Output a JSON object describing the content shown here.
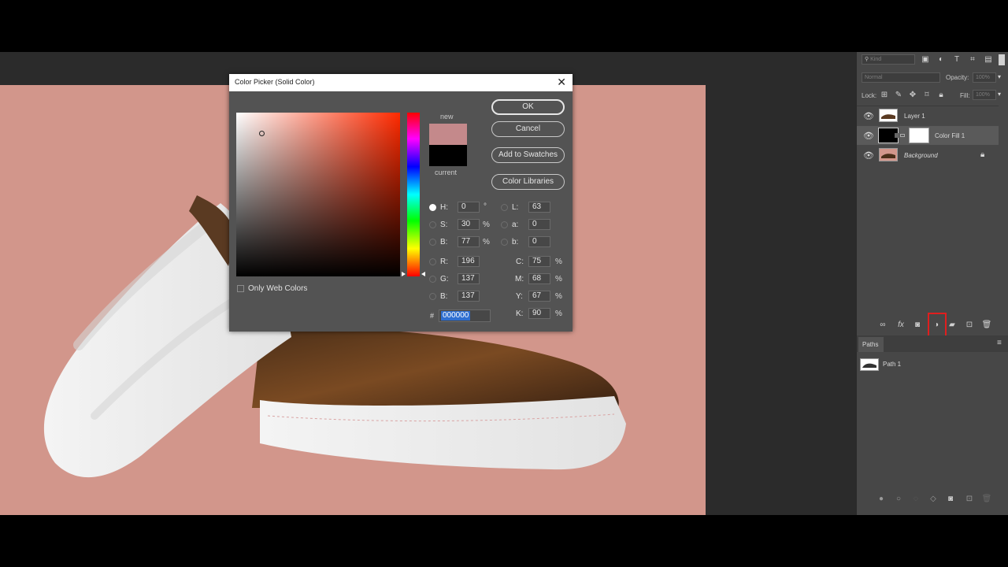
{
  "dialog": {
    "title": "Color Picker (Solid Color)",
    "buttons": {
      "ok": "OK",
      "cancel": "Cancel",
      "add_to_swatches": "Add to Swatches",
      "color_libraries": "Color Libraries"
    },
    "swatch_new_label": "new",
    "swatch_current_label": "current",
    "new_color": "#c4898b",
    "current_color": "#000000",
    "only_web_colors": "Only Web Colors",
    "fields": {
      "h": {
        "label": "H:",
        "value": "0",
        "unit": "°"
      },
      "s": {
        "label": "S:",
        "value": "30",
        "unit": "%"
      },
      "b": {
        "label": "B:",
        "value": "77",
        "unit": "%"
      },
      "r": {
        "label": "R:",
        "value": "196"
      },
      "g": {
        "label": "G:",
        "value": "137"
      },
      "bl": {
        "label": "B:",
        "value": "137"
      },
      "l": {
        "label": "L:",
        "value": "63"
      },
      "a": {
        "label": "a:",
        "value": "0"
      },
      "lab_b": {
        "label": "b:",
        "value": "0"
      },
      "c": {
        "label": "C:",
        "value": "75",
        "unit": "%"
      },
      "m": {
        "label": "M:",
        "value": "68",
        "unit": "%"
      },
      "y": {
        "label": "Y:",
        "value": "67",
        "unit": "%"
      },
      "k": {
        "label": "K:",
        "value": "90",
        "unit": "%"
      }
    },
    "hex_label": "#",
    "hex_value": "000000"
  },
  "layers_panel": {
    "search_placeholder": "Kind",
    "blend_mode": "Normal",
    "opacity_label": "Opacity:",
    "opacity_value": "100%",
    "lock_label": "Lock:",
    "fill_label": "Fill:",
    "fill_value": "100%",
    "layers": [
      {
        "name": "Layer 1"
      },
      {
        "name": "Color Fill 1"
      },
      {
        "name": "Background"
      }
    ]
  },
  "paths_panel": {
    "tab": "Paths",
    "items": [
      {
        "name": "Path 1"
      }
    ]
  },
  "colors": {
    "canvas_bg": "#d2968b",
    "highlight": "#e01e1e",
    "hex_selection": "#2f6fd0"
  }
}
